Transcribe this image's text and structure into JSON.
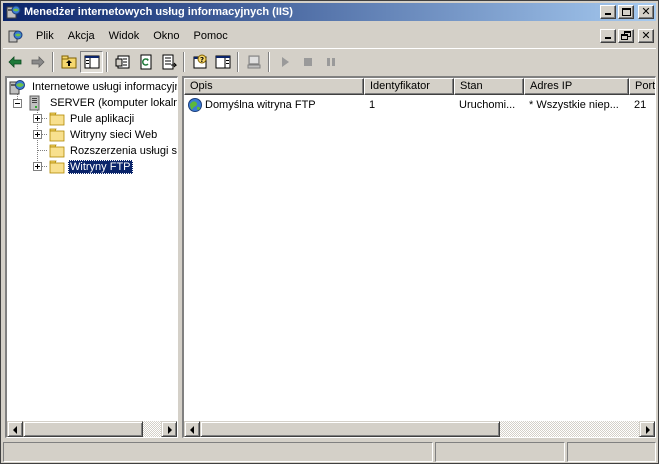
{
  "window": {
    "title": "Menedżer internetowych usług informacyjnych (IIS)",
    "icon": "iis-app-icon"
  },
  "menu": {
    "items": [
      {
        "label": "Plik"
      },
      {
        "label": "Akcja"
      },
      {
        "label": "Widok"
      },
      {
        "label": "Okno"
      },
      {
        "label": "Pomoc"
      }
    ]
  },
  "toolbar": {
    "buttons": [
      "back-arrow-icon",
      "forward-arrow-icon",
      "up-one-level-icon",
      "show-hide-console-tree-icon",
      "properties-icon",
      "refresh-icon",
      "export-list-icon",
      "help-icon",
      "show-hide-action-pane-icon",
      "computer-icon",
      "play-icon",
      "stop-icon",
      "pause-icon"
    ]
  },
  "tree": {
    "root": "Internetowe usługi informacyjne",
    "server": "SERVER (komputer lokalny)",
    "children": [
      {
        "label": "Pule aplikacji",
        "expandable": true
      },
      {
        "label": "Witryny sieci Web",
        "expandable": true
      },
      {
        "label": "Rozszerzenia usługi sieci Web",
        "expandable": false
      },
      {
        "label": "Witryny FTP",
        "expandable": true,
        "selected": true
      }
    ]
  },
  "list": {
    "columns": [
      "Opis",
      "Identyfikator",
      "Stan",
      "Adres IP",
      "Port"
    ],
    "rows": [
      {
        "opis": "Domyślna witryna FTP",
        "id": "1",
        "stan": "Uruchomi...",
        "ip": "* Wszystkie niep...",
        "port": "21"
      }
    ]
  },
  "colors": {
    "titlebar_start": "#0a246a",
    "titlebar_end": "#a6caf0",
    "selection": "#0a246a",
    "face": "#d4d0c8"
  }
}
